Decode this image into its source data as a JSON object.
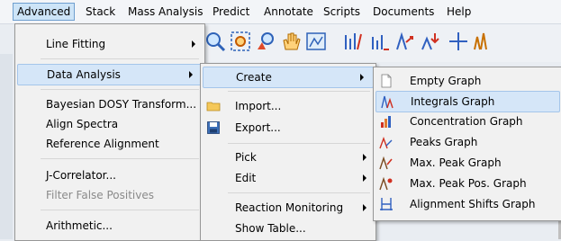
{
  "menubar": [
    "Advanced",
    "Stack",
    "Mass Analysis",
    "Predict",
    "Annotate",
    "Scripts",
    "Documents",
    "Help"
  ],
  "advanced_menu": [
    {
      "label": "Line Fitting",
      "submenu": true,
      "enabled": true
    },
    {
      "label": "Data Analysis",
      "submenu": true,
      "enabled": true,
      "highlighted": true
    },
    {
      "label": "Bayesian DOSY Transform...",
      "enabled": true
    },
    {
      "label": "Align Spectra",
      "enabled": true
    },
    {
      "label": "Reference Alignment",
      "enabled": true
    },
    {
      "label": "J-Correlator...",
      "enabled": true
    },
    {
      "label": "Filter False Positives",
      "enabled": false
    },
    {
      "label": "Arithmetic...",
      "enabled": true
    }
  ],
  "data_analysis_menu": [
    {
      "label": "Create",
      "submenu": true,
      "highlighted": true
    },
    {
      "label": "Import...",
      "icon": "folder-icon"
    },
    {
      "label": "Export...",
      "icon": "save-icon"
    },
    {
      "label": "Pick",
      "submenu": true
    },
    {
      "label": "Edit",
      "submenu": true
    },
    {
      "label": "Reaction Monitoring",
      "submenu": true
    },
    {
      "label": "Show Table..."
    }
  ],
  "create_menu": [
    {
      "label": "Empty Graph",
      "icon": "empty-graph-icon"
    },
    {
      "label": "Integrals Graph",
      "icon": "integrals-graph-icon",
      "highlighted": true
    },
    {
      "label": "Concentration Graph",
      "icon": "concentration-graph-icon"
    },
    {
      "label": "Peaks Graph",
      "icon": "peaks-graph-icon"
    },
    {
      "label": "Max. Peak Graph",
      "icon": "max-peak-graph-icon"
    },
    {
      "label": "Max. Peak Pos. Graph",
      "icon": "max-peak-pos-graph-icon"
    },
    {
      "label": "Alignment Shifts Graph",
      "icon": "alignment-shifts-graph-icon"
    }
  ],
  "colors": {
    "highlight": "#d5e6f8",
    "menu_bg": "#f1f1f1",
    "accent": "#3060c0"
  }
}
